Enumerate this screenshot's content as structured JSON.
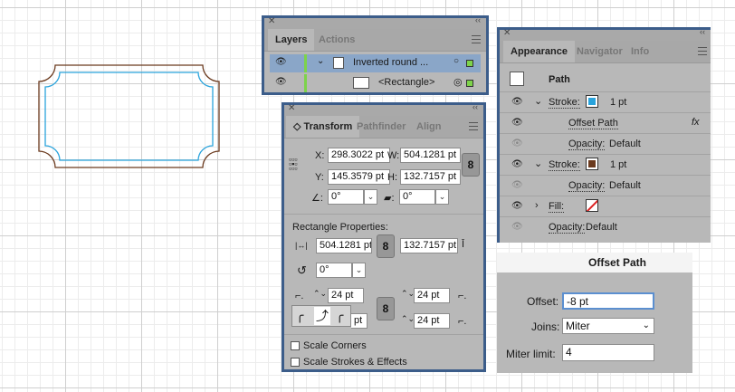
{
  "layers_panel": {
    "tabs": [
      "Layers",
      "Actions"
    ],
    "rows": [
      {
        "name": "Inverted round ..."
      },
      {
        "name": "<Rectangle>"
      }
    ]
  },
  "transform_panel": {
    "tabs": [
      "Transform",
      "Pathfinder",
      "Align"
    ],
    "x_label": "X:",
    "x_value": "298.3022 pt",
    "w_label": "W:",
    "w_value": "504.1281 pt",
    "y_label": "Y:",
    "y_value": "145.3579 pt",
    "h_label": "H:",
    "h_value": "132.7157 pt",
    "angle_value": "0°",
    "shear_value": "0°",
    "rect_props_label": "Rectangle Properties:",
    "rect_w_value": "504.1281 pt",
    "rect_h_value": "132.7157 pt",
    "rotate_value": "0°",
    "corner_tl": "24 pt",
    "corner_tr": "24 pt",
    "corner_bl": "pt",
    "corner_br": "24 pt",
    "scale_corners_label": "Scale Corners",
    "scale_strokes_label": "Scale Strokes & Effects"
  },
  "appearance_panel": {
    "tabs": [
      "Appearance",
      "Navigator",
      "Info"
    ],
    "path_label": "Path",
    "stroke1_label": "Stroke:",
    "stroke1_weight": "1 pt",
    "stroke1_color": "#29a3dc",
    "offset_path_label": "Offset Path",
    "fx_label": "fx",
    "opacity1_label": "Opacity:",
    "opacity1_value": "Default",
    "stroke2_label": "Stroke:",
    "stroke2_weight": "1 pt",
    "stroke2_color": "#6b3a1e",
    "opacity2_label": "Opacity:",
    "opacity2_value": "Default",
    "fill_label": "Fill:",
    "opacity3_label": "Opacity:",
    "opacity3_value": "Default"
  },
  "offset_dialog": {
    "title": "Offset Path",
    "offset_label": "Offset:",
    "offset_value": "-8 pt",
    "joins_label": "Joins:",
    "joins_value": "Miter",
    "miter_label": "Miter limit:",
    "miter_value": "4"
  },
  "colors": {
    "outer_stroke": "#6b3a1e",
    "inner_stroke": "#29a3dc",
    "selection": "#8aa6c8"
  }
}
